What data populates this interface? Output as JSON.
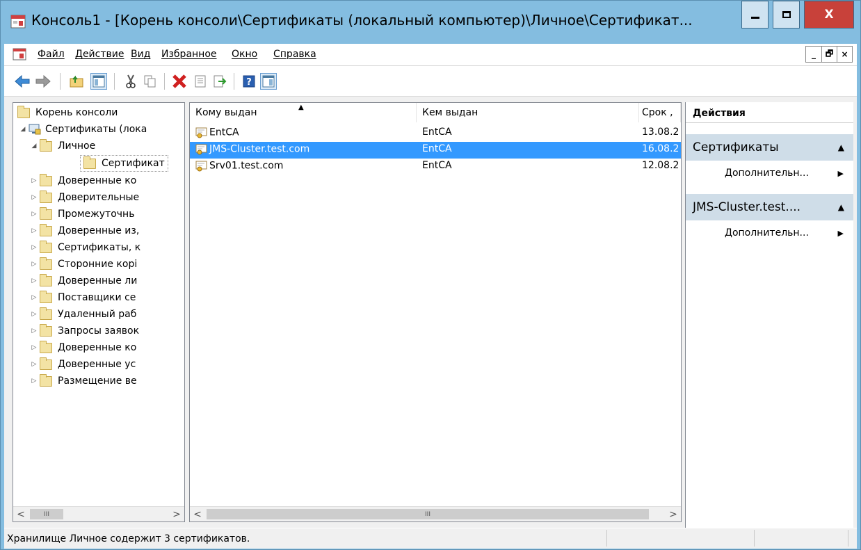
{
  "window": {
    "title": "Консоль1 - [Корень консоли\\Сертификаты (локальный компьютер)\\Личное\\Сертификат...",
    "minimize": "–",
    "maximize": "□",
    "close": "X"
  },
  "menu": {
    "items": [
      "Файл",
      "Действие",
      "Вид",
      "Избранное",
      "Окно",
      "Справка"
    ],
    "mdi": {
      "minimize": "_",
      "restore": "🗗",
      "close": "×"
    }
  },
  "toolbar": {
    "icons": [
      "back-icon",
      "forward-icon",
      "up-folder-icon",
      "show-hide-tree-icon",
      "cut-icon",
      "copy-icon",
      "delete-icon",
      "properties-icon",
      "export-list-icon",
      "help-icon",
      "show-hide-action-pane-icon"
    ]
  },
  "tree": {
    "root": "Корень консоли",
    "certs": "Сертификаты (лока",
    "personal": "Личное",
    "certificates": "Сертификат",
    "children": [
      "Доверенные ко",
      "Доверительные",
      "Промежуточнь",
      "Доверенные из,",
      "Сертификаты, к",
      "Сторонние корі",
      "Доверенные ли",
      "Поставщики се",
      "Удаленный раб",
      "Запросы заявок",
      "Доверенные ко",
      "Доверенные ус",
      "Размещение ве"
    ]
  },
  "list": {
    "columns": [
      "Кому выдан",
      "Кем выдан",
      "Срок ,"
    ],
    "rows": [
      {
        "issued_to": "EntCA",
        "issued_by": "EntCA",
        "expires": "13.08.2",
        "selected": false
      },
      {
        "issued_to": "JMS-Cluster.test.com",
        "issued_by": "EntCA",
        "expires": "16.08.2",
        "selected": true
      },
      {
        "issued_to": "Srv01.test.com",
        "issued_by": "EntCA",
        "expires": "12.08.2",
        "selected": false
      }
    ]
  },
  "actions": {
    "header": "Действия",
    "sections": [
      {
        "title": "Сертификаты",
        "item": "Дополнительн..."
      },
      {
        "title": "JMS-Cluster.test....",
        "item": "Дополнительн..."
      }
    ]
  },
  "status": {
    "text": "Хранилище Личное содержит 3 сертификатов."
  },
  "scroll": {
    "left": "<",
    "right": ">",
    "thumb": "III"
  },
  "colors": {
    "selection": "#3399ff",
    "title_bar": "#84bde0",
    "close_button": "#c8413a",
    "action_section": "#cfdde8"
  }
}
